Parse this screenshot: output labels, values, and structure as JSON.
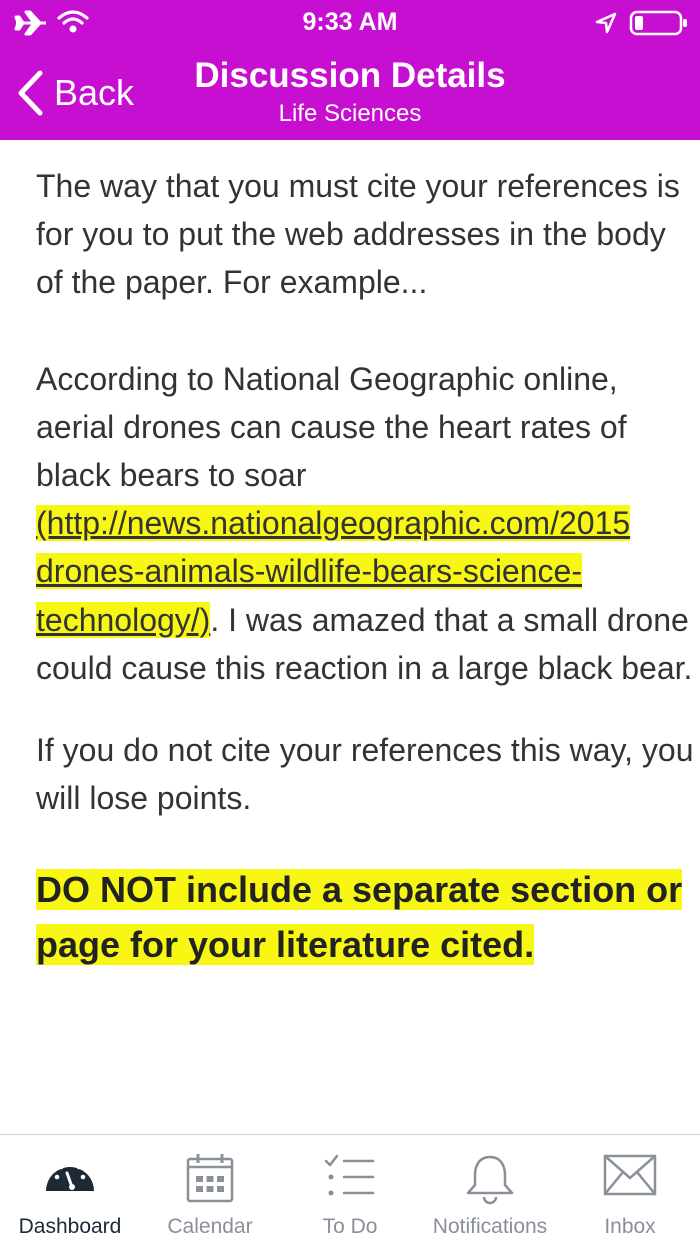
{
  "status_bar": {
    "time": "9:33 AM"
  },
  "header": {
    "back_label": "Back",
    "title": "Discussion Details",
    "subtitle": "Life Sciences"
  },
  "content": {
    "p1": "The way that you must cite your references is for you to put the web addresses in the body of the paper. For example...",
    "p2_a": "According to National Geographic online, aerial drones can cause the heart rates of black bears to soar ",
    "p2_link_1": "(http://news.nationalgeographic.com/2015",
    "p2_link_2": "drones-animals-wildlife-bears-science-",
    "p2_link_3": "technology/)",
    "p2_b": ". I was amazed that a small drone could cause this reaction in a large black bear.",
    "p3": "If you do not cite your references this way, you will lose points.",
    "warning": "DO NOT include a separate section or page for your literature cited."
  },
  "tabs": [
    {
      "label": "Dashboard",
      "icon": "dashboard-icon",
      "active": true
    },
    {
      "label": "Calendar",
      "icon": "calendar-icon"
    },
    {
      "label": "To Do",
      "icon": "todo-icon"
    },
    {
      "label": "Notifications",
      "icon": "bell-icon"
    },
    {
      "label": "Inbox",
      "icon": "mail-icon"
    }
  ],
  "colors": {
    "header": "#c60fd0",
    "highlight": "#f7f713",
    "tab_active": "#1d2935",
    "tab_inactive": "#8a9099"
  }
}
